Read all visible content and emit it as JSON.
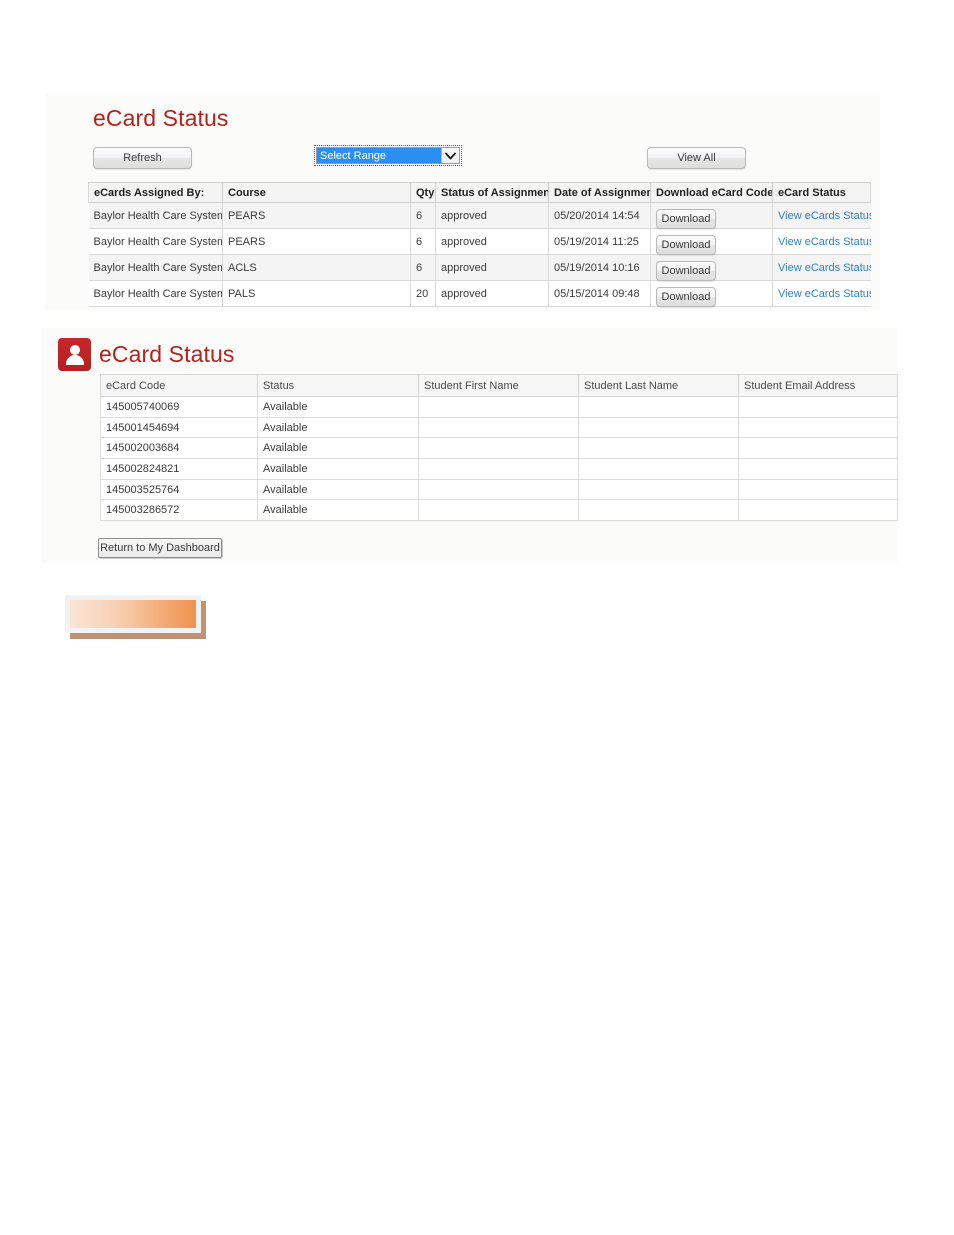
{
  "top_panel": {
    "heading": "eCard Status",
    "refresh_label": "Refresh",
    "view_all_label": "View All",
    "range_select": {
      "name": "select-range",
      "selected": "Select Range",
      "arrow_icon": "chevron-down-icon"
    },
    "table": {
      "headers": [
        "eCards Assigned By:",
        "Course",
        "Qty",
        "Status of Assignment",
        "Date of Assignment",
        "Download eCard Codes",
        "eCard Status"
      ],
      "rows": [
        {
          "assigned_by": "Baylor Health Care System",
          "course": "PEARS",
          "qty": "6",
          "status": "approved",
          "date": "05/20/2014 14:54",
          "download_label": "Download",
          "ecard_status_link": "View eCards Status"
        },
        {
          "assigned_by": "Baylor Health Care System",
          "course": "PEARS",
          "qty": "6",
          "status": "approved",
          "date": "05/19/2014 11:25",
          "download_label": "Download",
          "ecard_status_link": "View eCards Status"
        },
        {
          "assigned_by": "Baylor Health Care System",
          "course": "ACLS",
          "qty": "6",
          "status": "approved",
          "date": "05/19/2014 10:16",
          "download_label": "Download",
          "ecard_status_link": "View eCards Status"
        },
        {
          "assigned_by": "Baylor Health Care System",
          "course": "PALS",
          "qty": "20",
          "status": "approved",
          "date": "05/15/2014 09:48",
          "download_label": "Download",
          "ecard_status_link": "View eCards Status"
        }
      ]
    }
  },
  "bottom_panel": {
    "heading": "eCard Status",
    "heading_icon": "person-icon",
    "return_label": "Return to My Dashboard",
    "table": {
      "headers": [
        "eCard Code",
        "Status",
        "Student First Name",
        "Student Last Name",
        "Student Email Address"
      ],
      "rows": [
        {
          "code": "145005740069",
          "status": "Available",
          "first_name": "",
          "last_name": "",
          "email": ""
        },
        {
          "code": "145001454694",
          "status": "Available",
          "first_name": "",
          "last_name": "",
          "email": ""
        },
        {
          "code": "145002003684",
          "status": "Available",
          "first_name": "",
          "last_name": "",
          "email": ""
        },
        {
          "code": "145002824821",
          "status": "Available",
          "first_name": "",
          "last_name": "",
          "email": ""
        },
        {
          "code": "145003525764",
          "status": "Available",
          "first_name": "",
          "last_name": "",
          "email": ""
        },
        {
          "code": "145003286572",
          "status": "Available",
          "first_name": "",
          "last_name": "",
          "email": ""
        }
      ]
    }
  },
  "orange_bar": {
    "label": "",
    "gradient_from": "#fae5d6",
    "gradient_to": "#f0924f",
    "shadow_color": "#c09273"
  },
  "colors": {
    "heading_red": "#b3231f",
    "link_blue": "#2f7fc4",
    "select_highlight": "#2a8fef",
    "panel_bg": "#fbfbfa"
  }
}
